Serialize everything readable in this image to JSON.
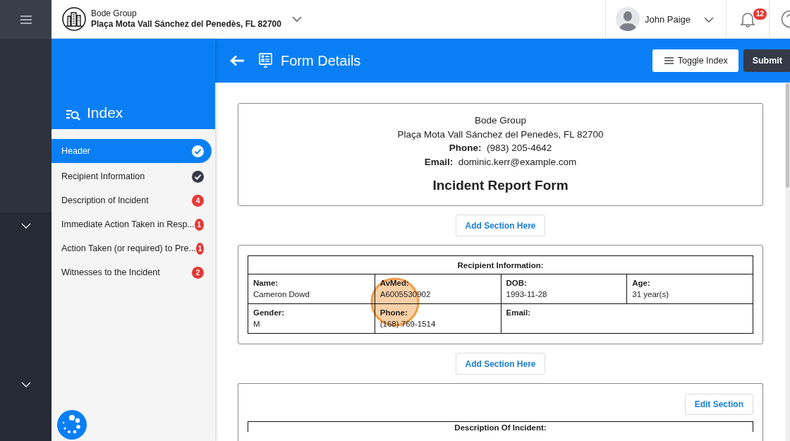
{
  "topbar": {
    "company": "Bode Group",
    "address": "Plaça Mota Vall Sánchez del Penedès, FL 82700",
    "user": "John Paige",
    "notifications": "12"
  },
  "toolbar": {
    "title": "Form Details",
    "buttons": [
      {
        "label": "Toggle Index",
        "kind": "toggle"
      },
      {
        "label": "Submit",
        "kind": "primary"
      }
    ]
  },
  "index": {
    "title": "Index",
    "items": [
      {
        "label": "Header",
        "selected": true,
        "completed": true
      },
      {
        "label": "Recipient Information",
        "selected": false,
        "completed": true
      },
      {
        "label": "Description of Incident",
        "selected": false,
        "completed": false,
        "count": "4"
      },
      {
        "label": "Immediate Action Taken in Resp...",
        "selected": false,
        "completed": false,
        "count": "1"
      },
      {
        "label": "Action Taken (or required) to Pre...",
        "selected": false,
        "completed": false,
        "count": "1"
      },
      {
        "label": "Witnesses to the Incident",
        "selected": false,
        "completed": false,
        "count": "2"
      }
    ]
  },
  "form": {
    "header": {
      "company": "Bode Group",
      "address": "Plaça Mota Vall Sánchez del Penedès, FL 82700",
      "phone": "**Phone:**  (983) 205-4642",
      "email": "**Email:**  dominic.kerr@example.com",
      "title": "Incident Report Form"
    },
    "add_section_buttons": [
      "Add Section Here",
      "Add Section Here"
    ],
    "recipient_table": {
      "title": "Recipient Information:",
      "rows": [
        [
          {
            "label": "Name:",
            "value": "Cameron Dowd"
          },
          {
            "label": "AvMed:",
            "value": "A6005530902"
          },
          {
            "label": "DOB:",
            "value": "1993-11-28"
          },
          {
            "label": "Age:",
            "value": "31 year(s)"
          }
        ],
        [
          {
            "label": "Gender:",
            "value": "M"
          },
          {
            "label": "Phone:",
            "value": "(168) 769-1514"
          },
          {
            "label": "Email:"
          }
        ]
      ]
    },
    "description_section": {
      "edit_button": "Edit Section",
      "table_title": "Description Of Incident:"
    }
  }
}
